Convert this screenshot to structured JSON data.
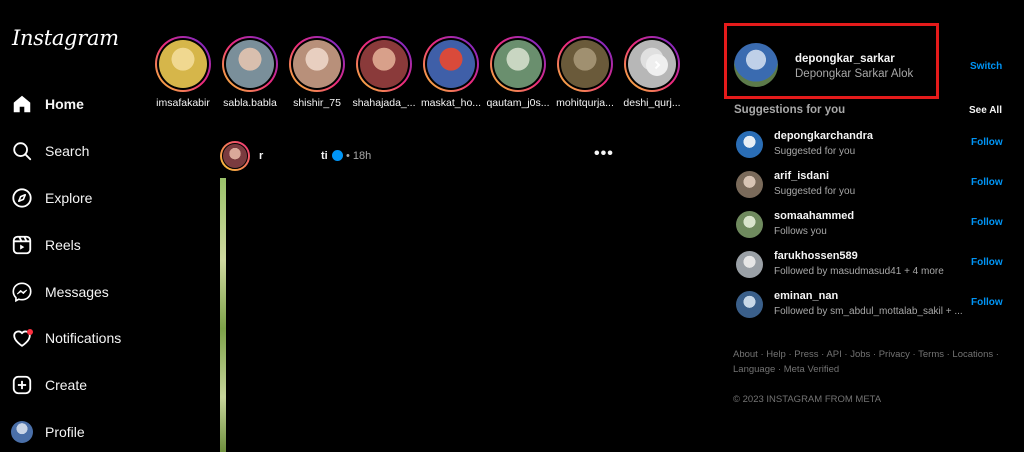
{
  "app": {
    "logo": "Instagram"
  },
  "nav": [
    {
      "label": "Home",
      "icon": "home-icon",
      "active": true
    },
    {
      "label": "Search",
      "icon": "search-icon"
    },
    {
      "label": "Explore",
      "icon": "compass-icon"
    },
    {
      "label": "Reels",
      "icon": "reels-icon"
    },
    {
      "label": "Messages",
      "icon": "messenger-icon"
    },
    {
      "label": "Notifications",
      "icon": "heart-icon"
    },
    {
      "label": "Create",
      "icon": "plus-square-icon"
    },
    {
      "label": "Profile",
      "icon": "avatar"
    }
  ],
  "stories": [
    {
      "name": "imsafakabir",
      "color": "#d6b64a"
    },
    {
      "name": "sabla.babla",
      "color": "#7a8f9a"
    },
    {
      "name": "shishir_75",
      "color": "#b8907a"
    },
    {
      "name": "shahajada_...",
      "color": "#8a3a3a"
    },
    {
      "name": "maskat_ho...",
      "color": "#3f5fa8"
    },
    {
      "name": "qautam_j0s...",
      "color": "#6a8f6e"
    },
    {
      "name": "mohitqurja...",
      "color": "#6a5a3a"
    },
    {
      "name": "deshi_qurj...",
      "color": "#b7b7b7"
    }
  ],
  "post": {
    "user": "r",
    "user2": "ti",
    "time": "• 18h",
    "more": "•••"
  },
  "me": {
    "username": "depongkar_sarkar",
    "fullname": "Depongkar Sarkar Alok",
    "switch": "Switch"
  },
  "suggestions": {
    "title": "Suggestions for you",
    "see_all": "See All",
    "items": [
      {
        "user": "depongkarchandra",
        "sub": "Suggested for you",
        "follow": "Follow",
        "color": "#2a6db5"
      },
      {
        "user": "arif_isdani",
        "sub": "Suggested for you",
        "follow": "Follow",
        "color": "#7a6a5a"
      },
      {
        "user": "somaahammed",
        "sub": "Follows you",
        "follow": "Follow",
        "color": "#6f8a5e"
      },
      {
        "user": "farukhossen589",
        "sub": "Followed by masudmasud41 + 4 more",
        "follow": "Follow",
        "color": "#9aa0a6"
      },
      {
        "user": "eminan_nan",
        "sub": "Followed by sm_abdul_mottalab_sakil + ...",
        "follow": "Follow",
        "color": "#3a5f8a"
      }
    ]
  },
  "footer": {
    "links": "About · Help · Press · API · Jobs · Privacy · Terms · Locations · Language · Meta Verified",
    "copyright": "© 2023 INSTAGRAM FROM META"
  }
}
